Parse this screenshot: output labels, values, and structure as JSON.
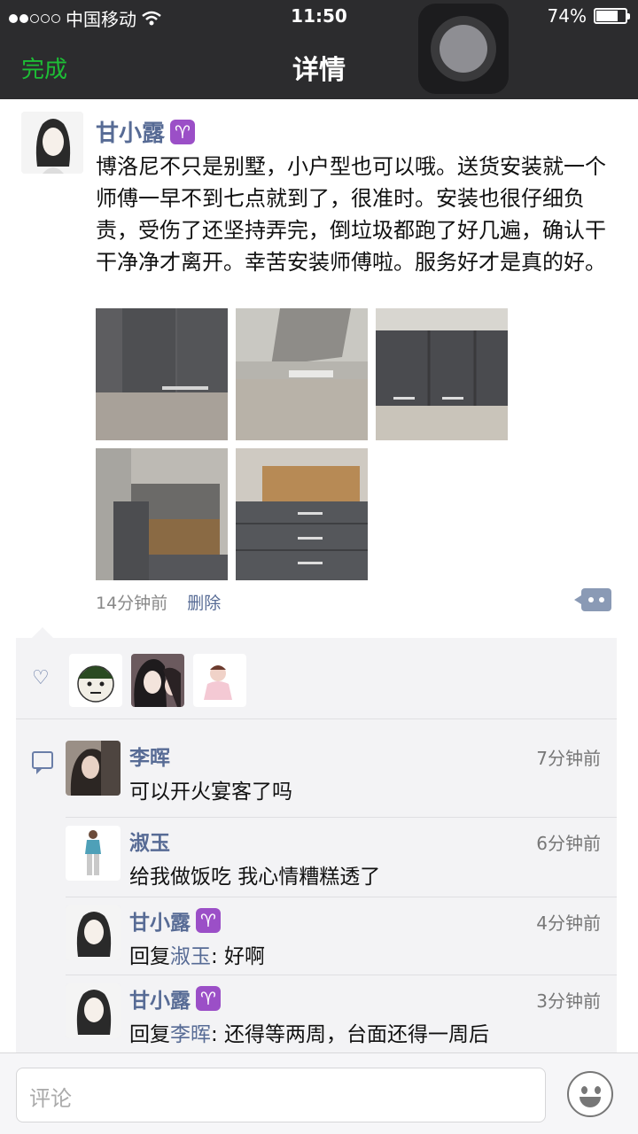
{
  "status_bar": {
    "carrier": "中国移动",
    "time": "11:50",
    "battery": "74%",
    "battery_level": 0.74
  },
  "nav": {
    "done_label": "完成",
    "title": "详情"
  },
  "post": {
    "author": "甘小露",
    "author_badge": "♈",
    "text": "博洛尼不只是别墅，小户型也可以哦。送货安装就一个师傅一早不到七点就到了，很准时。安装也很仔细负责，受伤了还坚持弄完，倒垃圾都跑了好几遍，确认干干净净才离开。幸苦安装师傅啦。服务好才是真的好。",
    "time": "14分钟前",
    "delete_label": "删除",
    "photo_count": 5
  },
  "likes": {
    "count": 3
  },
  "comments": [
    {
      "name": "李晖",
      "badge": "",
      "time": "7分钟前",
      "prefix": "",
      "reply_to": "",
      "suffix": "",
      "text": "可以开火宴客了吗"
    },
    {
      "name": "淑玉",
      "badge": "",
      "time": "6分钟前",
      "prefix": "",
      "reply_to": "",
      "suffix": "",
      "text": "给我做饭吃 我心情糟糕透了"
    },
    {
      "name": "甘小露",
      "badge": "♈",
      "time": "4分钟前",
      "prefix": "回复",
      "reply_to": "淑玉",
      "suffix": ": 好啊",
      "text": ""
    },
    {
      "name": "甘小露",
      "badge": "♈",
      "time": "3分钟前",
      "prefix": "回复",
      "reply_to": "李晖",
      "suffix": ": 还得等两周，台面还得一周后",
      "text": ""
    }
  ],
  "input": {
    "placeholder": "评论"
  },
  "colors": {
    "accent_green": "#1dbd35",
    "link_blue": "#576b95",
    "bar_dark": "#2c2c2e"
  },
  "icons": {
    "wifi": "wifi-icon",
    "heart": "heart-icon",
    "comment": "comment-icon",
    "emoji": "emoji-icon",
    "more": "more-icon"
  }
}
